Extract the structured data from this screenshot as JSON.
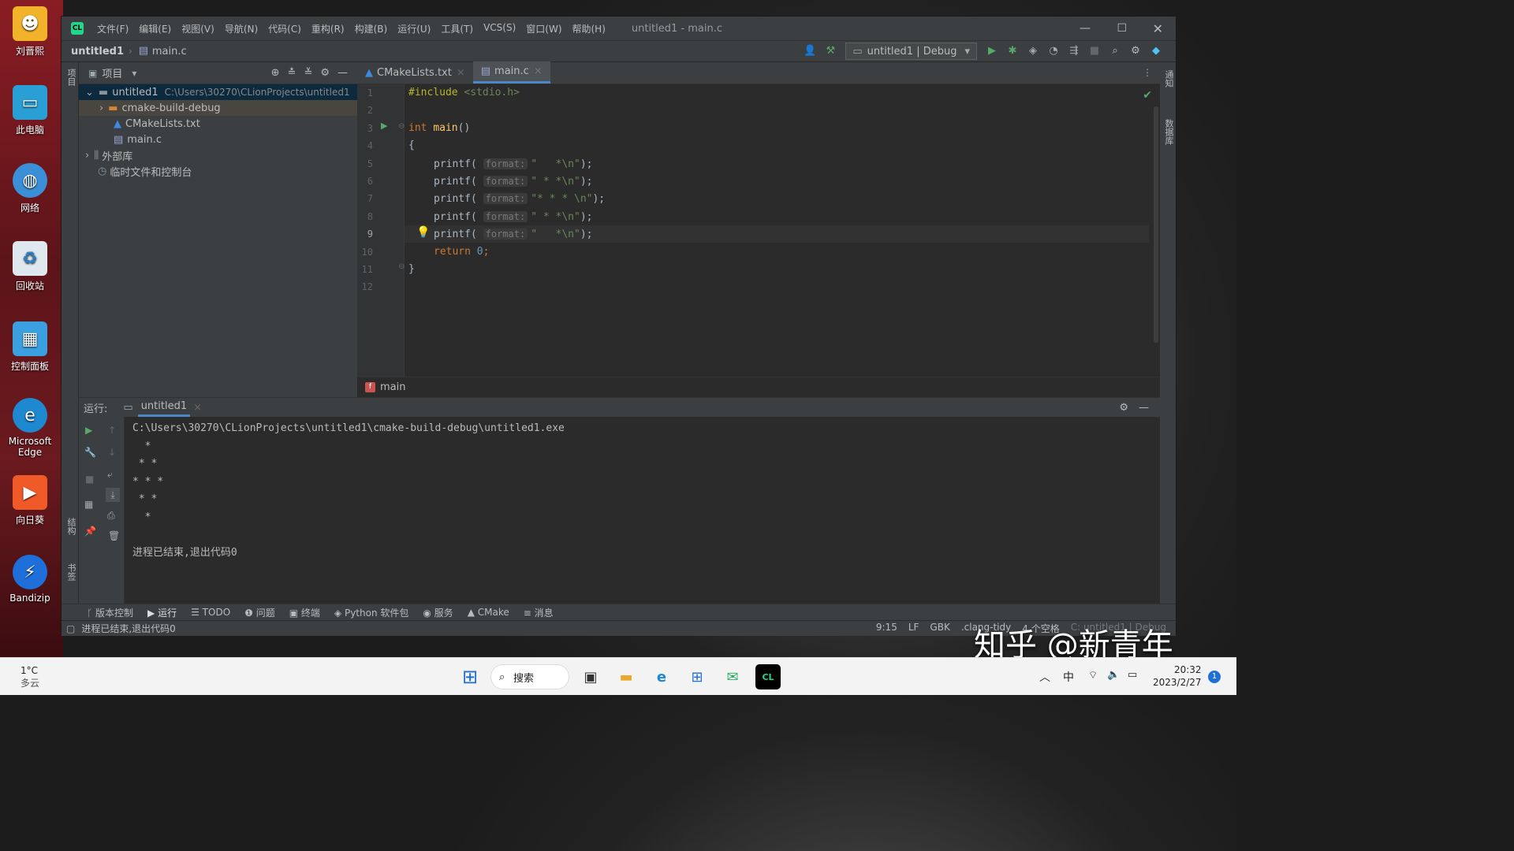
{
  "desktop": {
    "icons": [
      {
        "label": "刘晋熙",
        "icon": "folder-user-icon"
      },
      {
        "label": "此电脑",
        "icon": "computer-icon"
      },
      {
        "label": "网络",
        "icon": "network-icon"
      },
      {
        "label": "回收站",
        "icon": "recycle-bin-icon"
      },
      {
        "label": "控制面板",
        "icon": "control-panel-icon"
      },
      {
        "label": "Microsoft Edge",
        "icon": "edge-icon"
      },
      {
        "label": "向日葵",
        "icon": "sunlogin-icon"
      },
      {
        "label": "Bandizip",
        "icon": "bandizip-icon"
      }
    ]
  },
  "window": {
    "title": "untitled1 - main.c",
    "menu": [
      "文件(F)",
      "编辑(E)",
      "视图(V)",
      "导航(N)",
      "代码(C)",
      "重构(R)",
      "构建(B)",
      "运行(U)",
      "工具(T)",
      "VCS(S)",
      "窗口(W)",
      "帮助(H)"
    ]
  },
  "navbar": {
    "project": "untitled1",
    "file": "main.c",
    "run_config": "untitled1 | Debug"
  },
  "left_strip": {
    "project_label": "项目",
    "structure_label": "结构",
    "bookmarks_label": "书签"
  },
  "right_strip": {
    "notifications_label": "通知",
    "database_label": "数据库"
  },
  "project_panel": {
    "title": "项目",
    "root": {
      "name": "untitled1",
      "path": "C:\\Users\\30270\\CLionProjects\\untitled1"
    },
    "items": [
      {
        "name": "cmake-build-debug",
        "type": "folder"
      },
      {
        "name": "CMakeLists.txt",
        "type": "cmake"
      },
      {
        "name": "main.c",
        "type": "c"
      }
    ],
    "external": "外部库",
    "scratches": "临时文件和控制台"
  },
  "editor": {
    "tabs": [
      {
        "label": "CMakeLists.txt",
        "active": false
      },
      {
        "label": "main.c",
        "active": true
      }
    ],
    "line_numbers": [
      "1",
      "2",
      "3",
      "4",
      "5",
      "6",
      "7",
      "8",
      "9",
      "10",
      "11",
      "12"
    ],
    "code": {
      "include_kw": "#include",
      "include_file": "<stdio.h>",
      "main_type": "int",
      "main_name": "main",
      "main_parens": "()",
      "open_brace": "{",
      "printf": "printf(",
      "hint": "format:",
      "strings": [
        "\"   *\\n\"",
        "\" * *\\n\"",
        "\"* * * \\n\"",
        "\" * *\\n\"",
        "\"   *\\n\""
      ],
      "close_call": ");",
      "return_kw": "return",
      "return_val": "0",
      "semicolon": ";",
      "close_brace": "}"
    },
    "breadcrumb": "main"
  },
  "run_panel": {
    "label": "运行:",
    "tab": "untitled1",
    "output": [
      "C:\\Users\\30270\\CLionProjects\\untitled1\\cmake-build-debug\\untitled1.exe",
      "  *",
      " * *",
      "* * *",
      " * *",
      "  *",
      "",
      "进程已结束,退出代码0"
    ]
  },
  "bottom_tools": [
    "版本控制",
    "运行",
    "TODO",
    "问题",
    "终端",
    "Python 软件包",
    "服务",
    "CMake",
    "消息"
  ],
  "status": {
    "message": "进程已结束,退出代码0",
    "position": "9:15",
    "line_sep": "LF",
    "encoding": "GBK",
    "linter": ".clang-tidy",
    "indent": "4 个空格",
    "context": "C: untitled1 | Debug"
  },
  "taskbar": {
    "weather_temp": "1°C",
    "weather_desc": "多云",
    "search": "搜索",
    "ime": "中",
    "time": "20:32",
    "date": "2023/2/27",
    "notification_count": "1"
  },
  "watermark": "知乎 @新青年"
}
